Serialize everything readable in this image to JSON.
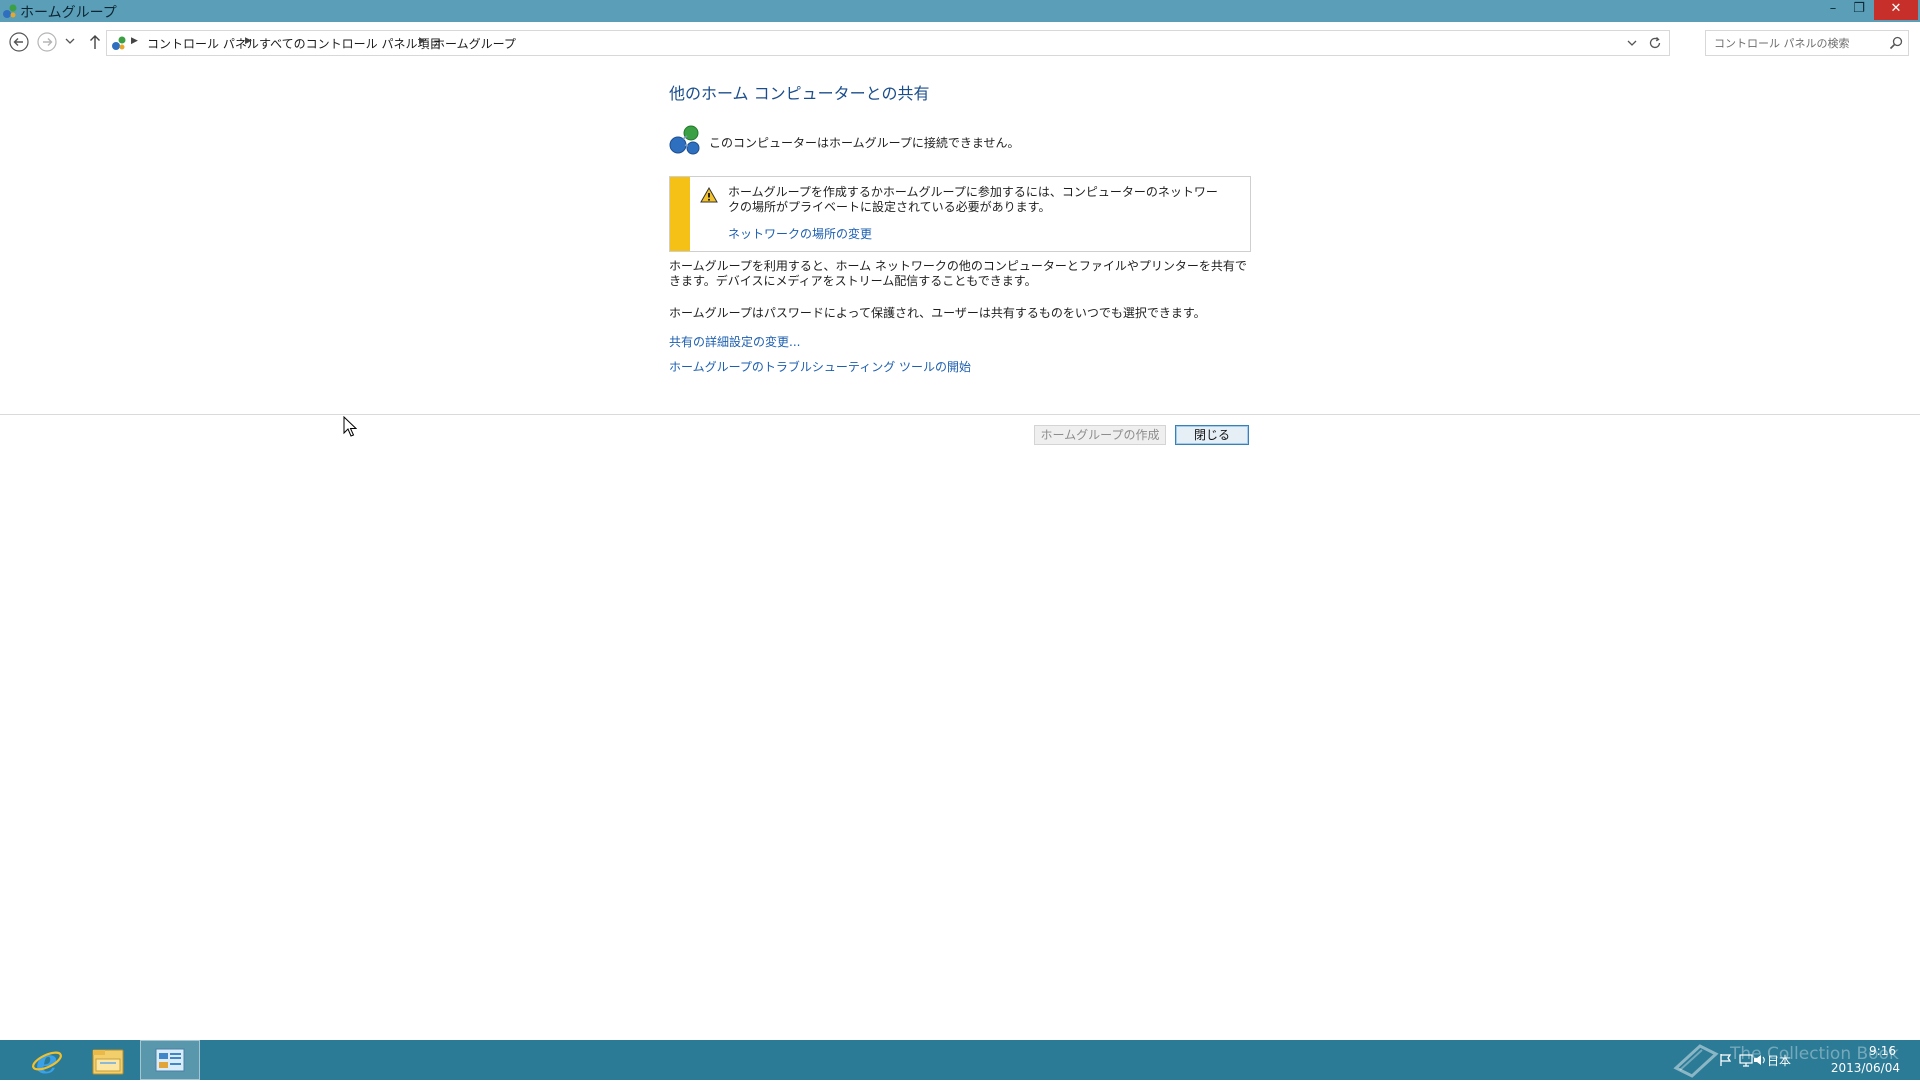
{
  "window": {
    "title": "ホームグループ"
  },
  "address_bar": {
    "breadcrumbs": [
      "コントロール パネル",
      "すべてのコントロール パネル項目",
      "ホームグループ"
    ]
  },
  "search": {
    "placeholder": "コントロール パネルの検索"
  },
  "main": {
    "heading": "他のホーム コンピューターとの共有",
    "status_text": "このコンピューターはホームグループに接続できません。",
    "warning": {
      "text": "ホームグループを作成するかホームグループに参加するには、コンピューターのネットワークの場所がプライベートに設定されている必要があります。",
      "link": "ネットワークの場所の変更",
      "stripe_color": "#f5c116"
    },
    "description_1": "ホームグループを利用すると、ホーム ネットワークの他のコンピューターとファイルやプリンターを共有できます。デバイスにメディアをストリーム配信することもできます。",
    "description_2": "ホームグループはパスワードによって保護され、ユーザーは共有するものをいつでも選択できます。",
    "links": {
      "advanced_sharing": "共有の詳細設定の変更...",
      "troubleshooter": "ホームグループのトラブルシューティング ツールの開始"
    }
  },
  "buttons": {
    "create_homegroup": "ホームグループの作成",
    "close": "閉じる"
  },
  "taskbar": {
    "pinned": [
      "internet-explorer-icon",
      "file-explorer-icon",
      "control-panel-icon"
    ],
    "tray": {
      "language": "日本",
      "time": "9:16",
      "date": "2013/06/04"
    },
    "watermark": "The Collection Book"
  },
  "colors": {
    "titlebar": "#5a9eb8",
    "taskbar": "#2b7a96",
    "link": "#1c5fb0",
    "heading": "#1b4e8c",
    "close_button": "#c7302a"
  }
}
